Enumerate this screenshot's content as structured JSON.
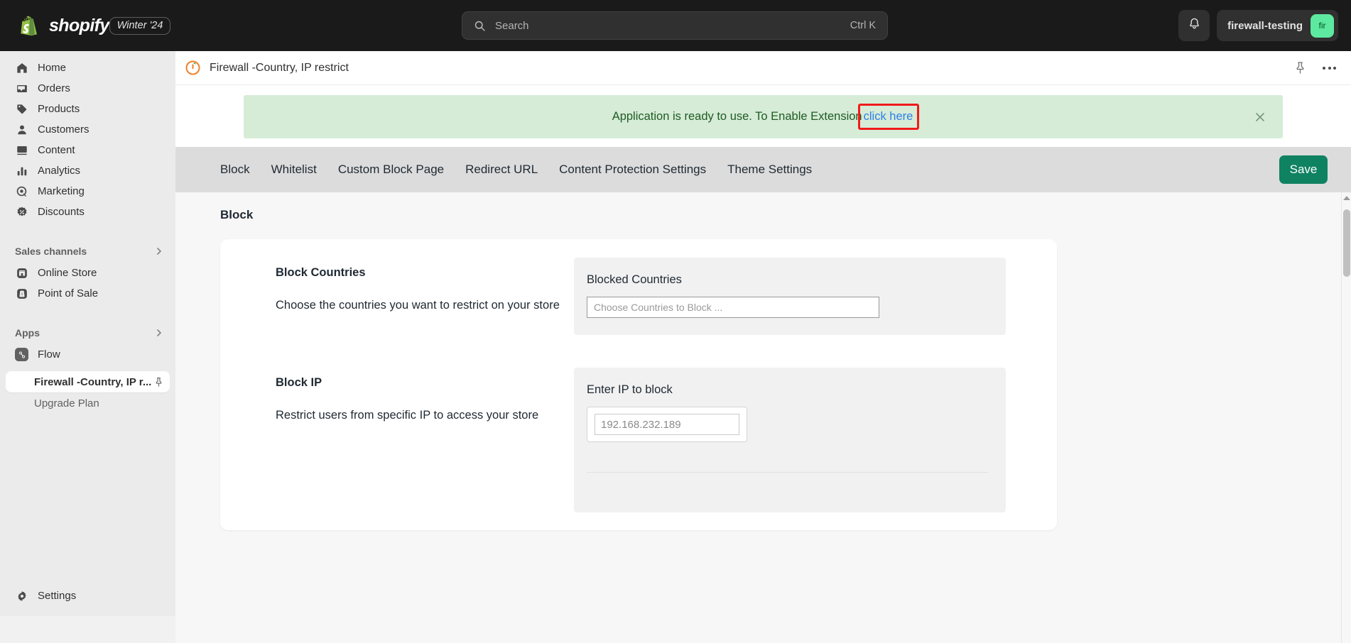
{
  "topbar": {
    "brand_name": "shopify",
    "brand_badge": "Winter '24",
    "brand_logo_icon": "shopify-bag-icon",
    "search": {
      "icon": "search-icon",
      "placeholder": "Search",
      "shortcut": "Ctrl K"
    },
    "notifications_icon": "bell-icon",
    "store_name": "firewall-testing",
    "store_avatar_initials": "fir",
    "avatar_color": "#5ee9a0"
  },
  "sidebar": {
    "items": [
      {
        "label": "Home",
        "icon": "home-icon"
      },
      {
        "label": "Orders",
        "icon": "orders-inbox-icon"
      },
      {
        "label": "Products",
        "icon": "products-tag-icon"
      },
      {
        "label": "Customers",
        "icon": "customers-person-icon"
      },
      {
        "label": "Content",
        "icon": "content-image-icon"
      },
      {
        "label": "Analytics",
        "icon": "analytics-bars-icon"
      },
      {
        "label": "Marketing",
        "icon": "marketing-target-icon"
      },
      {
        "label": "Discounts",
        "icon": "discounts-badge-icon"
      }
    ],
    "sections": [
      {
        "title": "Sales channels",
        "chevron_icon": "chevron-right-icon",
        "items": [
          {
            "label": "Online Store",
            "icon": "online-store-icon"
          },
          {
            "label": "Point of Sale",
            "icon": "point-of-sale-icon"
          }
        ]
      },
      {
        "title": "Apps",
        "chevron_icon": "chevron-right-icon",
        "items": [
          {
            "label": "Flow",
            "icon": "flow-app-icon"
          }
        ]
      }
    ],
    "app_subitems": [
      {
        "label": "Firewall -Country, IP r...",
        "active": true,
        "pin_icon": "pin-icon"
      },
      {
        "label": "Upgrade Plan",
        "active": false
      }
    ],
    "settings": {
      "label": "Settings",
      "icon": "gear-icon"
    }
  },
  "app_header": {
    "logo_icon": "firewall-app-logo-icon",
    "title": "Firewall -Country, IP restrict",
    "pin_icon": "pin-icon",
    "more_icon": "more-horizontal-icon"
  },
  "banner": {
    "message": "Application is ready to use. To Enable Extension",
    "link_label": "click here",
    "close_icon": "close-icon",
    "background_color": "#d6ecd7",
    "text_color": "#1e5b22",
    "link_color": "#2f7fe8",
    "annotation_color": "#f01b1b"
  },
  "tabs": [
    {
      "label": "Block",
      "active": true
    },
    {
      "label": "Whitelist",
      "active": false
    },
    {
      "label": "Custom Block Page",
      "active": false
    },
    {
      "label": "Redirect URL",
      "active": false
    },
    {
      "label": "Content Protection Settings",
      "active": false
    },
    {
      "label": "Theme Settings",
      "active": false
    }
  ],
  "save_button": {
    "label": "Save",
    "color": "#0f8262"
  },
  "main": {
    "section_title": "Block",
    "rows": [
      {
        "heading": "Block Countries",
        "description": "Choose the countries you want to restrict on your store",
        "panel_label": "Blocked Countries",
        "input_placeholder": "Choose Countries to Block ...",
        "input_value": ""
      },
      {
        "heading": "Block IP",
        "description": "Restrict users from specific IP to access your store",
        "panel_label": "Enter IP to block",
        "input_placeholder": "192.168.232.189",
        "input_value": ""
      }
    ]
  },
  "scrollbar": {
    "arrow_icon": "scroll-up-arrow-icon"
  }
}
